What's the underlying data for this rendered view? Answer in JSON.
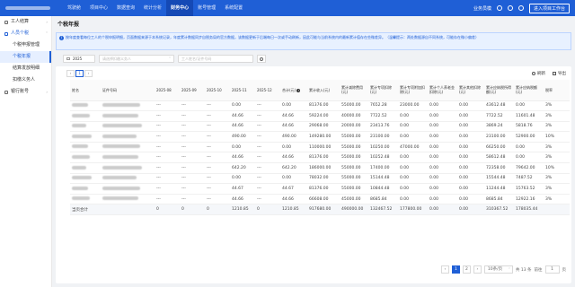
{
  "nav": {
    "items": [
      "驾驶舱",
      "项目中心",
      "数据查询",
      "统计分析",
      "财务中心",
      "账号管理",
      "系统配置"
    ],
    "active_index": 4,
    "right": {
      "mode_label": "业务员模",
      "enter_label": "进入项目工作台"
    }
  },
  "sidebar": {
    "group1": "工人结算",
    "group2": "人员个税",
    "subs": [
      "个税申报管理",
      "个税年报",
      "结算发放明细",
      "扣缴义务人"
    ],
    "active_sub": 1,
    "group3": "银行账号"
  },
  "page": {
    "title": "个税年报",
    "notice": "按年度查看每位工人的个税申报明细，页面数据来源于本系统记录，年度累计数据同步自税务局的官方数据，该数据更新于后端每日一次或手动刷新，因此可能与当前系统内的最新累计值存在些微差异。（温馨提示：两处数据源自不同系统，可能存在微小偏差）"
  },
  "filters": {
    "year": "2025",
    "withholder_placeholder": "请选择扣缴义务人",
    "name_placeholder": "工人姓名/证件号码"
  },
  "toolbar": {
    "refresh": "刷新",
    "export": "导出"
  },
  "table": {
    "headers": [
      "姓名",
      "证件号码",
      "2025-08",
      "2025-09",
      "2025-10",
      "2025-11",
      "2025-12",
      "合计(元)",
      "累计收入(元)",
      "累计减除费用(元)",
      "累计专项扣除(元)",
      "累计专项附加扣除(元)",
      "累计个人养老金扣除(元)",
      "累计其他扣除(元)",
      "累计应纳税所得额(元)",
      "累计应纳税额(元)",
      "税率"
    ],
    "rows": [
      [
        "---",
        "---",
        "---",
        "0.00",
        "---",
        "0.00",
        "81376.00",
        "55000.00",
        "7652.28",
        "23000.00",
        "0.00",
        "0.00",
        "43612.48",
        "0.00",
        "3%"
      ],
      [
        "---",
        "---",
        "---",
        "44.66",
        "---",
        "44.66",
        "59224.00",
        "40000.00",
        "7722.52",
        "0.00",
        "0.00",
        "0.00",
        "7722.52",
        "11601.48",
        "3%"
      ],
      [
        "---",
        "---",
        "---",
        "44.66",
        "---",
        "44.66",
        "29068.00",
        "20000.00",
        "23413.76",
        "0.00",
        "0.00",
        "0.00",
        "3869.24",
        "5818.76",
        "3%"
      ],
      [
        "---",
        "---",
        "---",
        "490.00",
        "---",
        "490.00",
        "149280.00",
        "55000.00",
        "23100.00",
        "0.00",
        "0.00",
        "0.00",
        "23100.00",
        "52900.00",
        "10%"
      ],
      [
        "---",
        "---",
        "---",
        "0.00",
        "---",
        "0.00",
        "110000.00",
        "55000.00",
        "10250.00",
        "47000.00",
        "0.00",
        "0.00",
        "66250.00",
        "0.00",
        "3%"
      ],
      [
        "---",
        "---",
        "---",
        "44.66",
        "---",
        "44.66",
        "81376.00",
        "55000.00",
        "10252.48",
        "0.00",
        "0.00",
        "0.00",
        "58612.48",
        "0.00",
        "3%"
      ],
      [
        "---",
        "---",
        "---",
        "642.20",
        "---",
        "642.20",
        "186000.00",
        "55000.00",
        "17400.00",
        "0.00",
        "0.00",
        "0.00",
        "72358.00",
        "79642.00",
        "10%"
      ],
      [
        "---",
        "---",
        "---",
        "0.00",
        "---",
        "0.00",
        "78032.00",
        "55000.00",
        "15144.48",
        "0.00",
        "0.00",
        "0.00",
        "15544.48",
        "7487.52",
        "3%"
      ],
      [
        "---",
        "---",
        "---",
        "44.67",
        "---",
        "44.67",
        "81376.00",
        "55000.00",
        "10844.48",
        "0.00",
        "0.00",
        "0.00",
        "11244.48",
        "15763.52",
        "3%"
      ],
      [
        "---",
        "---",
        "---",
        "44.66",
        "---",
        "44.66",
        "66608.00",
        "45000.00",
        "8685.84",
        "0.00",
        "0.00",
        "0.00",
        "8685.84",
        "12922.16",
        "3%"
      ]
    ],
    "total": {
      "label": "当页合计",
      "cols": [
        "0",
        "0",
        "0",
        "1210.85",
        "0",
        "1210.85",
        "917680.00",
        "490000.00",
        "132467.52",
        "177800.00",
        "0.00",
        "0.00",
        "310367.52",
        "178035.44",
        ""
      ]
    }
  },
  "pagination": {
    "top_pages": [
      "1"
    ],
    "pages": [
      "1",
      "2"
    ],
    "current": "1",
    "page_size": "10条/页",
    "total_label": "共 13 条",
    "jump_label": "前往",
    "jump_value": "1",
    "page_suffix": "页"
  }
}
